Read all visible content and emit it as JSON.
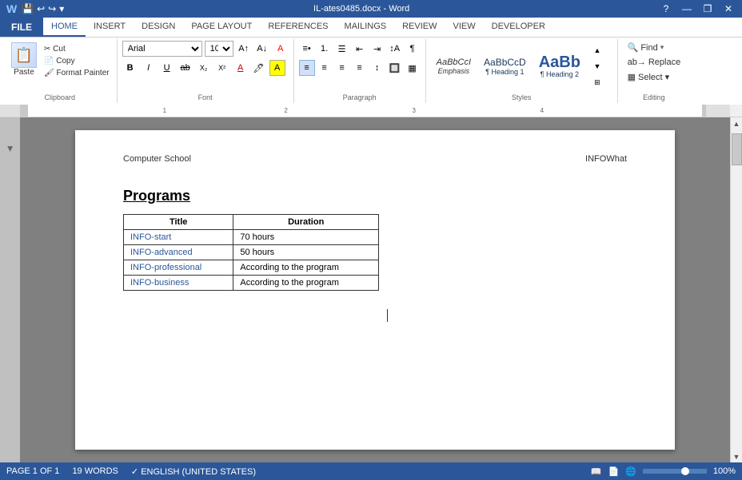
{
  "titlebar": {
    "title": "IL-ates0485.docx - Word",
    "help_btn": "?",
    "minimize_btn": "—",
    "restore_btn": "❒",
    "close_btn": "✕"
  },
  "qat": {
    "save_label": "💾",
    "undo_label": "↩",
    "redo_label": "↪",
    "dropdown_label": "▾"
  },
  "tabs": {
    "file": "FILE",
    "home": "HOME",
    "insert": "INSERT",
    "design": "DESIGN",
    "page_layout": "PAGE LAYOUT",
    "references": "REFERENCES",
    "mailings": "MAILINGS",
    "review": "REVIEW",
    "view": "VIEW",
    "developer": "DEVELOPER"
  },
  "ribbon": {
    "clipboard_label": "Clipboard",
    "font_label": "Font",
    "paragraph_label": "Paragraph",
    "styles_label": "Styles",
    "editing_label": "Editing",
    "font_name": "Arial",
    "font_size": "10",
    "find_label": "Find",
    "replace_label": "Replace",
    "select_label": "Select ▾",
    "style_emphasis": "AaBbCcI",
    "style_emphasis_name": "Emphasis",
    "style_h1_text": "AaBbCcD",
    "style_h1_name": "¶ Heading 1",
    "style_h2_text": "AaBb",
    "style_h2_name": "¶ Heading 2"
  },
  "document": {
    "header_left": "Computer School",
    "header_right": "INFOWhat",
    "section_title": "Programs",
    "table": {
      "headers": [
        "Title",
        "Duration"
      ],
      "rows": [
        [
          "INFO-start",
          "70 hours"
        ],
        [
          "INFO-advanced",
          "50 hours"
        ],
        [
          "INFO-professional",
          "According to the program"
        ],
        [
          "INFO-business",
          "According to the program"
        ]
      ]
    }
  },
  "statusbar": {
    "page_info": "PAGE 1 OF 1",
    "word_count": "19 WORDS",
    "language": "ENGLISH (UNITED STATES)",
    "zoom": "100%"
  }
}
